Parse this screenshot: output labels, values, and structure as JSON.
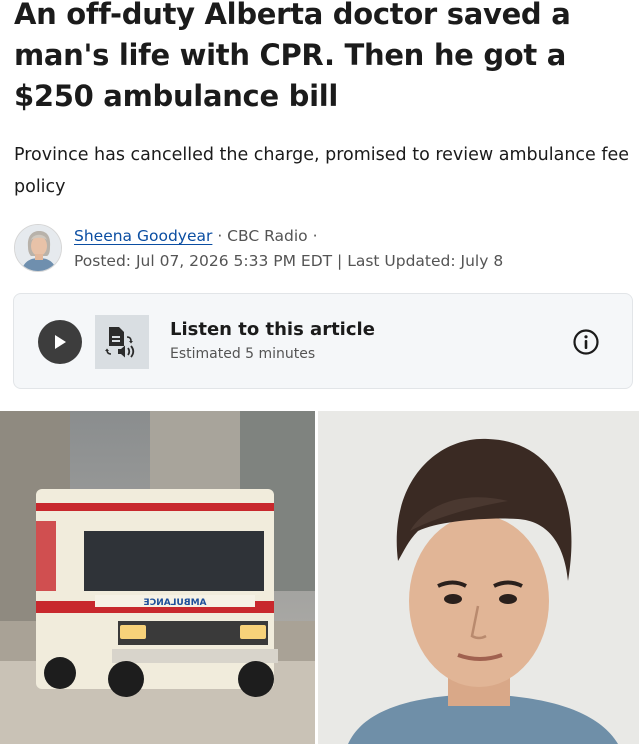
{
  "article": {
    "headline": "An off-duty Alberta doctor saved a man's life with CPR. Then he got a $250 ambulance bill",
    "deck": "Province has cancelled the charge, promised to review ambulance fee policy"
  },
  "byline": {
    "author": "Sheena Goodyear",
    "separator1": " · ",
    "source": "CBC Radio",
    "separator2": " ·",
    "posted": "Posted: Jul 07, 2026 5:33 PM EDT | Last Updated: July 8"
  },
  "listen": {
    "title": "Listen to this article",
    "estimate": "Estimated 5 minutes"
  },
  "photos": {
    "left_vehicle_text": "AMBULANCE"
  },
  "colors": {
    "link": "#0b4ea2",
    "card_background": "#f5f7f9",
    "play_button": "#3d3d3d",
    "ambulance_stripe": "#c8282d"
  },
  "icons": {
    "play": "play-icon",
    "text_to_speech": "text-to-speech-icon",
    "info": "info-icon"
  }
}
